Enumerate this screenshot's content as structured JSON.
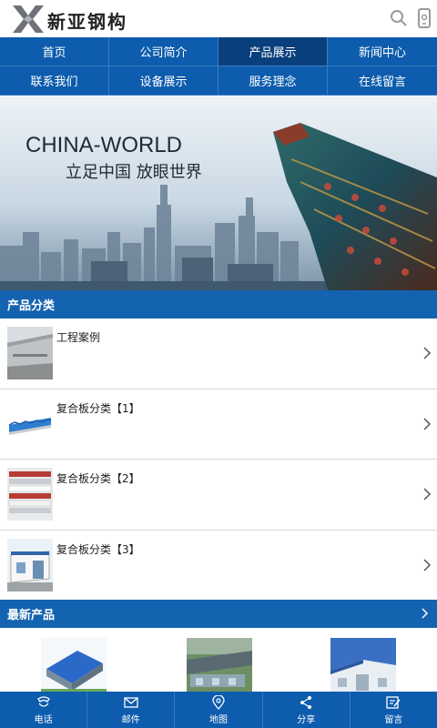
{
  "header": {
    "logo_text": "新亚钢构",
    "search_icon": "search-icon",
    "phone_icon": "mobile-phone-icon"
  },
  "nav": {
    "items": [
      {
        "label": "首页"
      },
      {
        "label": "公司简介"
      },
      {
        "label": "产品展示",
        "active": true
      },
      {
        "label": "新闻中心"
      },
      {
        "label": "联系我们"
      },
      {
        "label": "设备展示"
      },
      {
        "label": "服务理念"
      },
      {
        "label": "在线留言"
      }
    ]
  },
  "banner": {
    "title": "CHINA-WORLD",
    "subtitle": "立足中国 放眼世界"
  },
  "categories": {
    "heading": "产品分类",
    "items": [
      {
        "label": "工程案例"
      },
      {
        "label": "复合板分类【1】"
      },
      {
        "label": "复合板分类【2】"
      },
      {
        "label": "复合板分类【3】"
      }
    ]
  },
  "latest": {
    "heading": "最新产品"
  },
  "bottom_bar": {
    "items": [
      {
        "label": "电话",
        "icon": "phone-icon"
      },
      {
        "label": "邮件",
        "icon": "mail-icon"
      },
      {
        "label": "地图",
        "icon": "map-pin-icon"
      },
      {
        "label": "分享",
        "icon": "share-icon"
      },
      {
        "label": "留言",
        "icon": "message-edit-icon"
      }
    ]
  },
  "colors": {
    "primary": "#0d5cad",
    "section": "#1463b0",
    "active_nav": "#0a3f7d"
  }
}
